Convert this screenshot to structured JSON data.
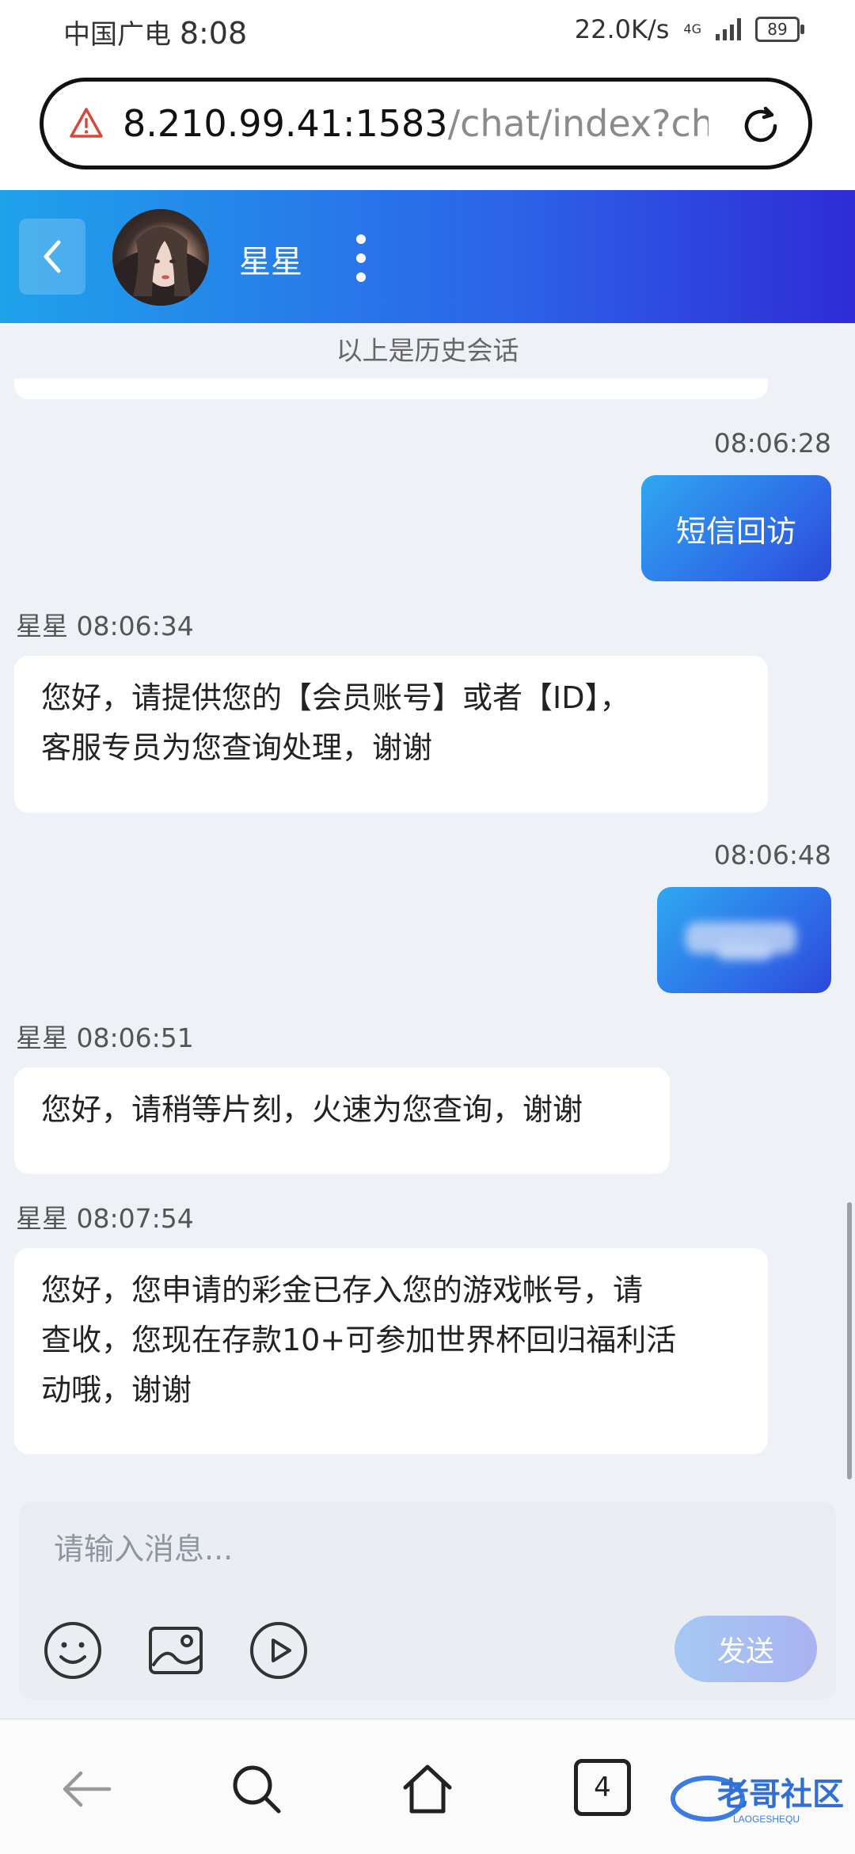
{
  "status_bar": {
    "carrier": "中国广电",
    "time": "8:08",
    "network_speed": "22.0K/s",
    "network_type": "4G",
    "battery": "89"
  },
  "browser": {
    "url_host": "8.210.99.41:1583",
    "url_path": "/chat/index?char",
    "warning_icon": "warning-triangle-icon",
    "reload_icon": "reload-icon"
  },
  "chat_header": {
    "contact_name": "星星",
    "back_icon": "chevron-left-icon",
    "more_icon": "vertical-dots-icon"
  },
  "chat": {
    "history_note": "以上是历史会话",
    "messages": [
      {
        "direction": "out",
        "time": "08:06:28",
        "text": "短信回访"
      },
      {
        "direction": "in",
        "sender_time": "星星 08:06:34",
        "text_lines": [
          "您好，请提供您的【会员账号】或者【ID】，",
          "客服专员为您查询处理，谢谢"
        ]
      },
      {
        "direction": "out",
        "time": "08:06:48",
        "text": "redacted"
      },
      {
        "direction": "in",
        "sender_time": "星星 08:06:51",
        "text_lines": [
          "您好，请稍等片刻，火速为您查询，谢谢"
        ]
      },
      {
        "direction": "in",
        "sender_time": "星星 08:07:54",
        "text_lines": [
          "您好，您申请的彩金已存入您的游戏帐号，请",
          "查收，您现在存款10+可参加世界杯回归福利活",
          "动哦，谢谢"
        ]
      }
    ]
  },
  "composer": {
    "placeholder": "请输入消息...",
    "send_label": "发送",
    "tools": [
      "emoji-icon",
      "image-icon",
      "video-icon"
    ]
  },
  "bottom_nav": {
    "tab_count": "4",
    "watermark": "老哥社区",
    "watermark_sub": "LAOGESHEQU"
  },
  "colors": {
    "header_gradient_start": "#1fa2ea",
    "header_gradient_end": "#2f2cd6",
    "page_bg": "#eef1f5",
    "send_button": "#a6c8f3"
  }
}
